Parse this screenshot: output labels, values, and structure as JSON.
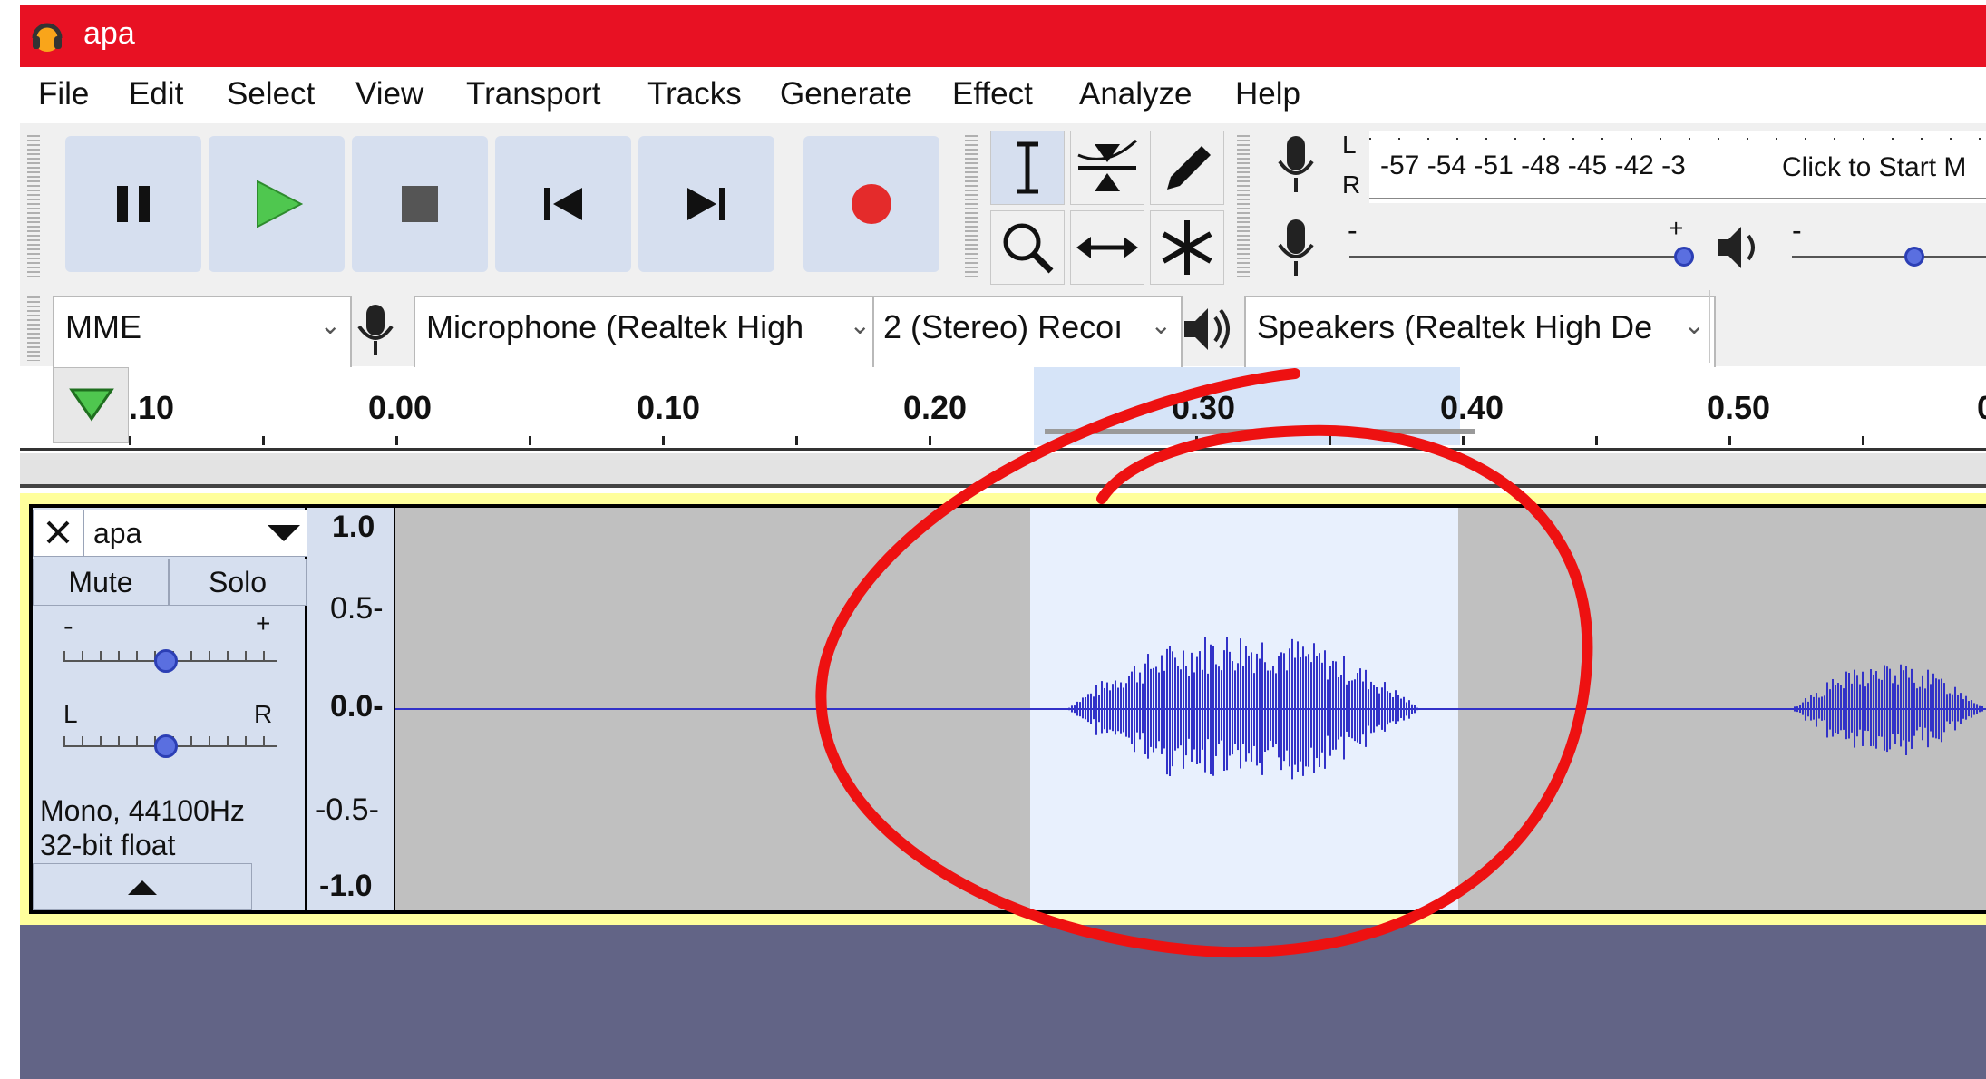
{
  "window": {
    "title": "apa"
  },
  "menu": [
    "File",
    "Edit",
    "Select",
    "View",
    "Transport",
    "Tracks",
    "Generate",
    "Effect",
    "Analyze",
    "Help"
  ],
  "transport": {
    "buttons": [
      "pause",
      "play",
      "stop",
      "skip-to-start",
      "skip-to-end",
      "record"
    ]
  },
  "tools": [
    "selection-tool",
    "envelope-tool",
    "draw-tool",
    "zoom-tool",
    "time-shift-tool",
    "multi-tool"
  ],
  "meter": {
    "lr_top": "L",
    "lr_bottom": "R",
    "scale": "-57 -54 -51 -48 -45 -42 -3",
    "click_label": "Click to Start M",
    "minus": "-",
    "plus": "+"
  },
  "device": {
    "host": "MME",
    "input": "Microphone (Realtek High",
    "channels": "2 (Stereo) Recoı",
    "output": "Speakers (Realtek High De"
  },
  "ruler": {
    "labels": [
      ".10",
      "0.00",
      "0.10",
      "0.20",
      "0.30",
      "0.40",
      "0.50",
      "0"
    ]
  },
  "track": {
    "name": "apa",
    "mute": "Mute",
    "solo": "Solo",
    "gain_minus": "-",
    "gain_plus": "+",
    "pan_left": "L",
    "pan_right": "R",
    "info_line1": "Mono, 44100Hz",
    "info_line2": "32-bit float",
    "scale": [
      "1.0",
      "0.5-",
      "0.0-",
      "-0.5-",
      "-1.0"
    ]
  },
  "colors": {
    "titlebar": "#e81123",
    "waveform": "#3232c8",
    "selection": "#e8f0fd",
    "annotation": "#ee1111"
  }
}
